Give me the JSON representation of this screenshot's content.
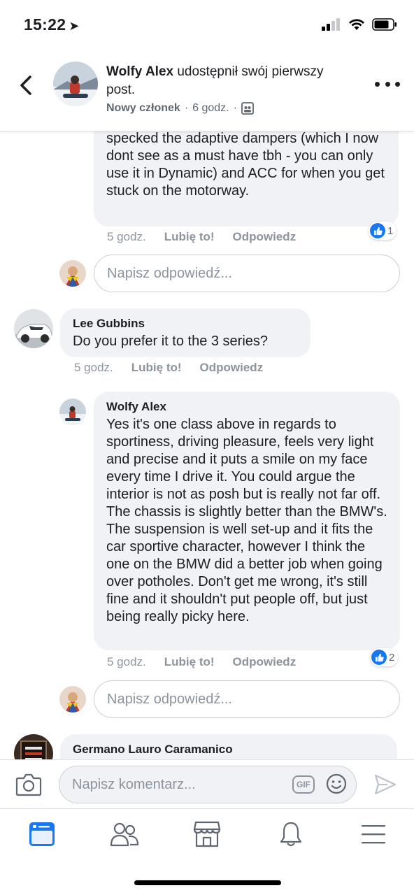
{
  "status_bar": {
    "time": "15:22"
  },
  "header": {
    "author": "Wolfy Alex",
    "action_text": " udostępnił swój pierwszy post.",
    "badge": "Nowy członek",
    "separator": "·",
    "time": "6 godz.",
    "separator2": "·"
  },
  "comments": [
    {
      "text": "specked the adaptive dampers (which I now dont see as a must have tbh - you can only use it in Dynamic)  and ACC for when you get stuck on the motorway.",
      "time": "5 godz.",
      "like_label": "Lubię to!",
      "reply_label": "Odpowiedz",
      "reactions": "1"
    },
    {
      "author": "Lee Gubbins",
      "text": "Do you prefer it to the 3 series?",
      "time": "5 godz.",
      "like_label": "Lubię to!",
      "reply_label": "Odpowiedz"
    },
    {
      "author": "Wolfy Alex",
      "text": "Yes it's one class above in regards to sportiness, driving pleasure, feels very light and precise and it puts a smile on my face every time I drive it. You could argue the interior is not as posh but is really not far off. The chassis is slightly better than the BMW's. The suspension is well set-up and it fits the car sportive character, however I think the one on the BMW did a better job when going over potholes. Don't get me wrong, it's still fine and it shouldn't put people off, but just being really picky here.",
      "time": "5 godz.",
      "like_label": "Lubię to!",
      "reply_label": "Odpowiedz",
      "reactions": "2"
    },
    {
      "author": "Germano Lauro Caramanico"
    }
  ],
  "reply_placeholder": "Napisz odpowiedź...",
  "composer": {
    "placeholder": "Napisz komentarz...",
    "gif_label": "GIF"
  },
  "colors": {
    "accent": "#1877f2",
    "bubble": "#f0f2f5",
    "muted": "#8d949e"
  },
  "icons": [
    "back-icon",
    "more-icon",
    "group-icon",
    "thumb-up-icon",
    "camera-icon",
    "gif-icon",
    "emoji-icon",
    "send-icon",
    "news-feed-icon",
    "friends-icon",
    "marketplace-icon",
    "bell-icon",
    "menu-icon"
  ]
}
